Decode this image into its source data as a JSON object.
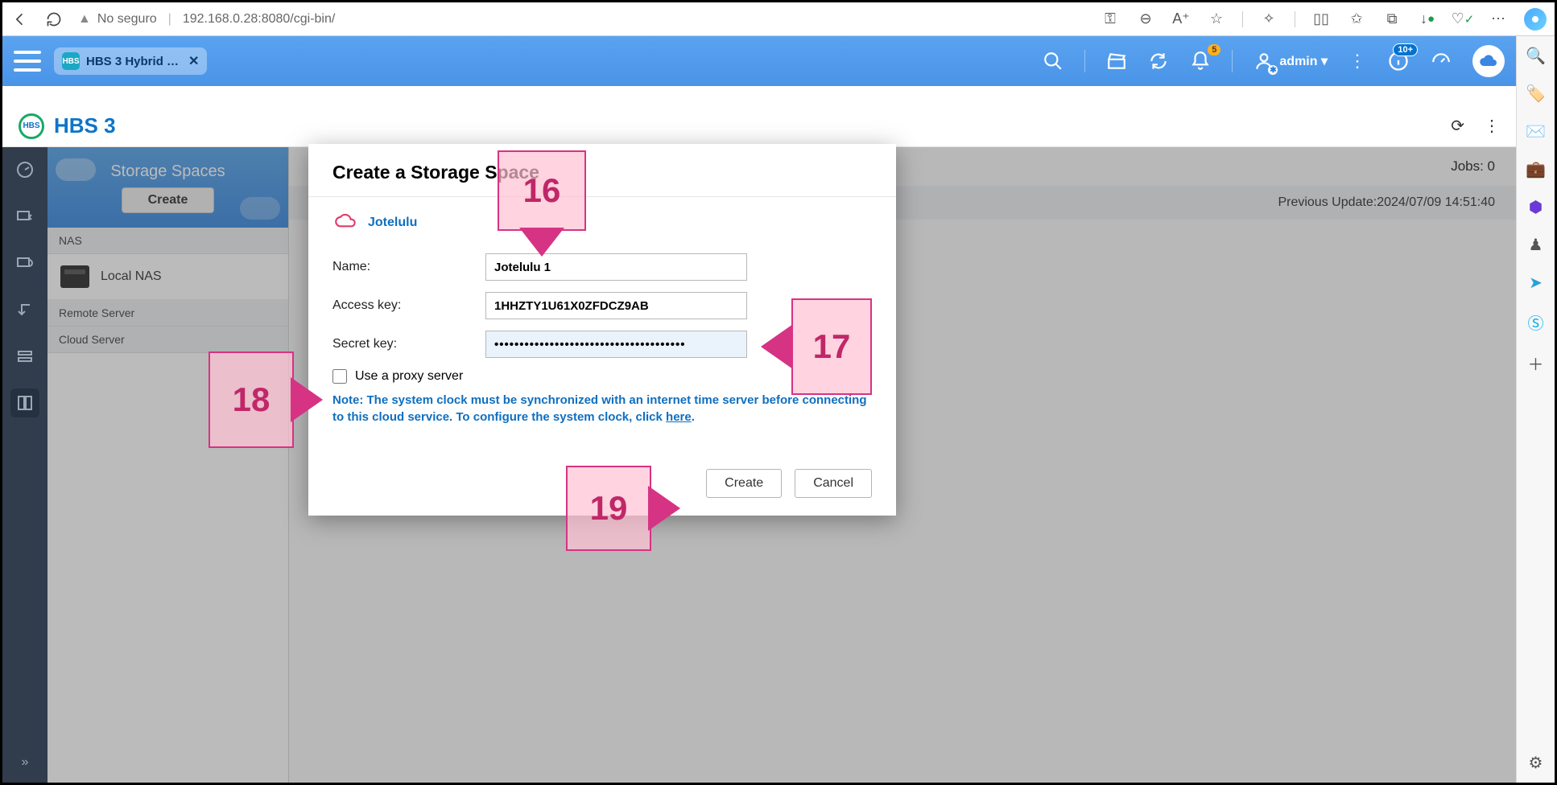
{
  "browser": {
    "insecure_label": "No seguro",
    "url": "192.168.0.28:8080/cgi-bin/"
  },
  "qnap_bar": {
    "tab_title": "HBS 3 Hybrid …",
    "user_label": "admin ▾",
    "notif_badge": "5",
    "info_badge": "10+"
  },
  "app": {
    "title": "HBS 3",
    "jobs_label": "Jobs: 0",
    "prev_update_label": "Previous Update:2024/07/09 14:51:40"
  },
  "side": {
    "hero_title": "Storage Spaces",
    "create_label": "Create",
    "section_nas": "NAS",
    "local_nas": "Local NAS",
    "remote_server": "Remote Server",
    "cloud_server": "Cloud Server"
  },
  "modal": {
    "title": "Create a Storage Space",
    "provider": "Jotelulu",
    "name_label": "Name:",
    "name_value": "Jotelulu 1",
    "access_label": "Access key:",
    "access_value": "1HHZTY1U61X0ZFDCZ9AB",
    "secret_label": "Secret key:",
    "secret_value": "••••••••••••••••••••••••••••••••••••••",
    "proxy_label": "Use a proxy server",
    "note_prefix": "Note: The system clock must be synchronized with an internet time server before connecting to this cloud service. To configure the system clock, click ",
    "note_link": "here",
    "create_btn": "Create",
    "cancel_btn": "Cancel"
  },
  "callouts": {
    "c16": "16",
    "c17": "17",
    "c18": "18",
    "c19": "19"
  }
}
